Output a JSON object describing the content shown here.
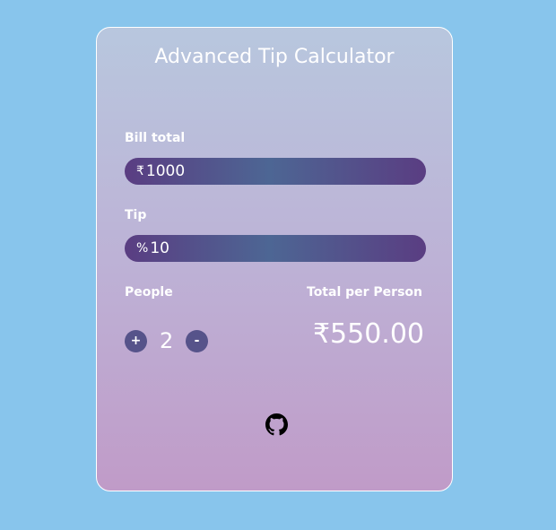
{
  "app": {
    "title": "Advanced Tip Calculator"
  },
  "bill": {
    "label": "Bill total",
    "prefix": "₹",
    "value": "1000"
  },
  "tip": {
    "label": "Tip",
    "prefix": "%",
    "value": "10"
  },
  "people": {
    "label": "People",
    "increment_label": "+",
    "count": "2",
    "decrement_label": "-"
  },
  "total": {
    "label": "Total per Person",
    "value": "₹550.00"
  },
  "footer": {
    "icon": "github-icon"
  },
  "colors": {
    "page_background": "#88c5ec",
    "field_accent": "#4d6694"
  }
}
